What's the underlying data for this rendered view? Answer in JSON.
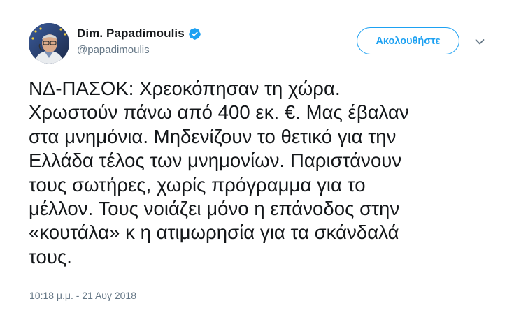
{
  "author": {
    "display_name": "Dim. Papadimoulis",
    "handle": "@papadimoulis",
    "verified": true,
    "avatar_icon": "profile-photo"
  },
  "follow_button": {
    "label": "Ακολουθήστε"
  },
  "menu": {
    "icon": "chevron-down-icon"
  },
  "tweet": {
    "lines": [
      "ΝΔ-ΠΑΣΟΚ: Χρεοκόπησαν τη χώρα.",
      "Χρωστούν πάνω από 400 εκ. €. Μας έβαλαν",
      "στα μνημόνια. Μηδενίζουν το θετικό για την",
      "Ελλάδα τέλος των μνημονίων. Παριστάνουν",
      "τους σωτήρες, χωρίς πρόγραμμα για το",
      "μέλλον. Τους νοιάζει μόνο η επάνοδος στην",
      "«κουτάλα» κ η ατιμωρησία για τα σκάνδαλά",
      "τους."
    ],
    "timestamp": "10:18 μ.μ. - 21 Αυγ 2018"
  },
  "colors": {
    "accent": "#1da1f2",
    "text": "#14171a",
    "secondary": "#657786"
  }
}
